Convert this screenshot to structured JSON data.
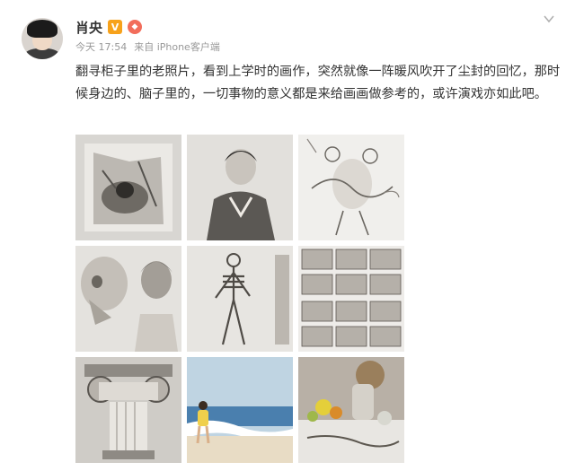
{
  "post": {
    "username": "肖央",
    "meta": {
      "time": "今天 17:54",
      "source": "来自 iPhone客户端"
    },
    "text": "翻寻柜子里的老照片，看到上学时的画作，突然就像一阵暖风吹开了尘封的回忆，那时候身边的、脑子里的，一切事物的意义都是来给画画做参考的，或许演戏亦如此吧。",
    "icons": {
      "verified": "verified-badge-icon",
      "fan": "fan-badge-icon",
      "more": "chevron-down-icon"
    }
  },
  "images": [
    {
      "subject": "sketch-reclining-figure"
    },
    {
      "subject": "charcoal-portrait-sweater"
    },
    {
      "subject": "figure-sketches"
    },
    {
      "subject": "plaster-skull-and-portrait"
    },
    {
      "subject": "skeleton-drawing"
    },
    {
      "subject": "storyboard-frames"
    },
    {
      "subject": "ionic-capital-drawing"
    },
    {
      "subject": "beach-painting-with-child"
    },
    {
      "subject": "still-life-painting"
    }
  ]
}
